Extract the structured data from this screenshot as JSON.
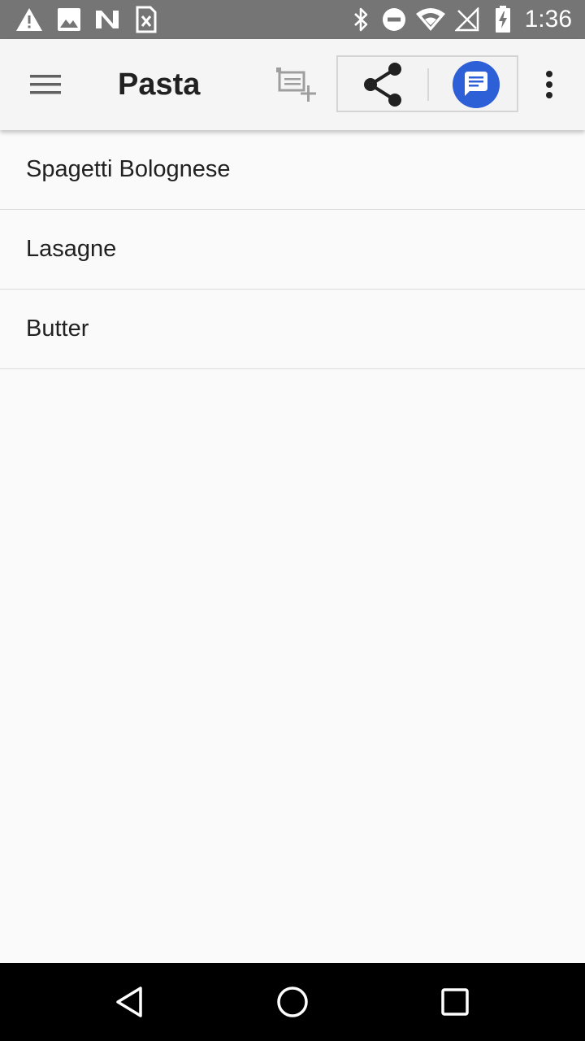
{
  "status_bar": {
    "time": "1:36",
    "icons_left": [
      "warning-icon",
      "image-icon",
      "n-logo-icon",
      "sim-card-x-icon"
    ],
    "icons_right": [
      "bluetooth-icon",
      "do-not-disturb-icon",
      "wifi-icon",
      "signal-off-icon",
      "battery-charging-icon"
    ]
  },
  "app_bar": {
    "title": "Pasta",
    "actions": [
      "menu-icon",
      "add-list-icon",
      "share-icon",
      "messages-icon",
      "more-vert-icon"
    ],
    "colors": {
      "background": "#f5f5f5",
      "messages_accent": "#2d5fd6"
    }
  },
  "list": {
    "items": [
      {
        "label": "Spagetti Bolognese"
      },
      {
        "label": "Lasagne"
      },
      {
        "label": "Butter"
      }
    ]
  },
  "nav_bar": {
    "buttons": [
      "back-icon",
      "home-icon",
      "recents-icon"
    ]
  }
}
